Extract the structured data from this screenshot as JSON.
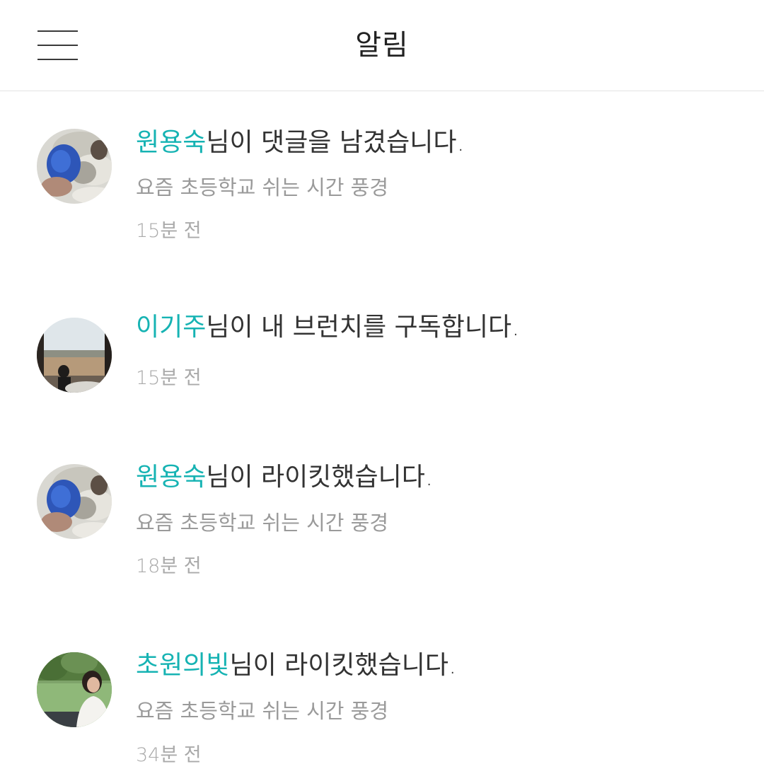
{
  "header": {
    "title": "알림",
    "menu_icon": "hamburger-menu-icon"
  },
  "notifications": [
    {
      "user": "원용숙",
      "message": "님이 댓글을 남겼습니다.",
      "article": "요즘 초등학교 쉬는 시간 풍경",
      "time": "15분 전"
    },
    {
      "user": "이기주",
      "message": "님이 내 브런치를 구독합니다.",
      "time": "15분 전"
    },
    {
      "user": "원용숙",
      "message": "님이 라이킷했습니다.",
      "article": "요즘 초등학교 쉬는 시간 풍경",
      "time": "18분 전"
    },
    {
      "user": "초원의빛",
      "message": "님이 라이킷했습니다.",
      "article": "요즘 초등학교 쉬는 시간 풍경",
      "time": "34분 전"
    }
  ],
  "colors": {
    "accent": "#16b3b3",
    "text": "#333333",
    "secondary": "#9a9a9a",
    "divider": "#e3e3e3"
  }
}
